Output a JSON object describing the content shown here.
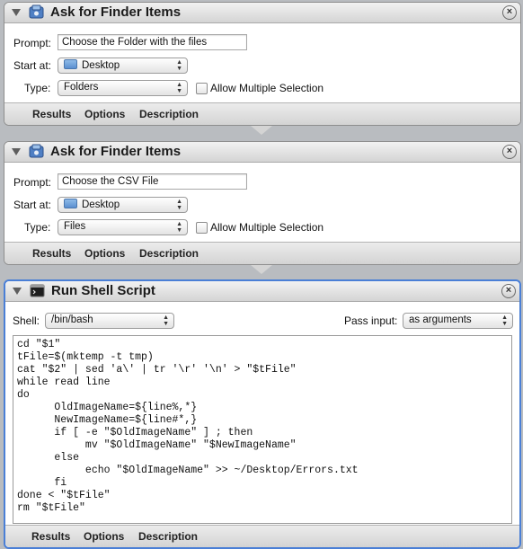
{
  "actions": [
    {
      "title": "Ask for Finder Items",
      "prompt_label": "Prompt:",
      "prompt_value": "Choose the Folder with the files",
      "start_label": "Start at:",
      "start_value": "Desktop",
      "type_label": "Type:",
      "type_value": "Folders",
      "allow_multiple": "Allow Multiple Selection",
      "tabs": [
        "Results",
        "Options",
        "Description"
      ]
    },
    {
      "title": "Ask for Finder Items",
      "prompt_label": "Prompt:",
      "prompt_value": "Choose the CSV File",
      "start_label": "Start at:",
      "start_value": "Desktop",
      "type_label": "Type:",
      "type_value": "Files",
      "allow_multiple": "Allow Multiple Selection",
      "tabs": [
        "Results",
        "Options",
        "Description"
      ]
    },
    {
      "title": "Run Shell Script",
      "shell_label": "Shell:",
      "shell_value": "/bin/bash",
      "pass_label": "Pass input:",
      "pass_value": "as arguments",
      "script": "cd \"$1\"\ntFile=$(mktemp -t tmp)\ncat \"$2\" | sed 'a\\' | tr '\\r' '\\n' > \"$tFile\"\nwhile read line\ndo\n      OldImageName=${line%,*}\n      NewImageName=${line#*,}\n      if [ -e \"$OldImageName\" ] ; then\n           mv \"$OldImageName\" \"$NewImageName\"\n      else\n           echo \"$OldImageName\" >> ~/Desktop/Errors.txt\n      fi\ndone < \"$tFile\"\nrm \"$tFile\"",
      "tabs": [
        "Results",
        "Options",
        "Description"
      ]
    }
  ],
  "close_glyph": "×",
  "popup_arrows": "▲▼",
  "icons": {
    "finder_action": "automator-finder-icon",
    "shell_action": "terminal-icon",
    "disclosure": "disclosure-triangle-icon",
    "close": "close-icon",
    "folder": "folder-icon"
  },
  "colors": {
    "selected_border": "#4a7fd6",
    "workflow_bg": "#b9bcc0"
  }
}
